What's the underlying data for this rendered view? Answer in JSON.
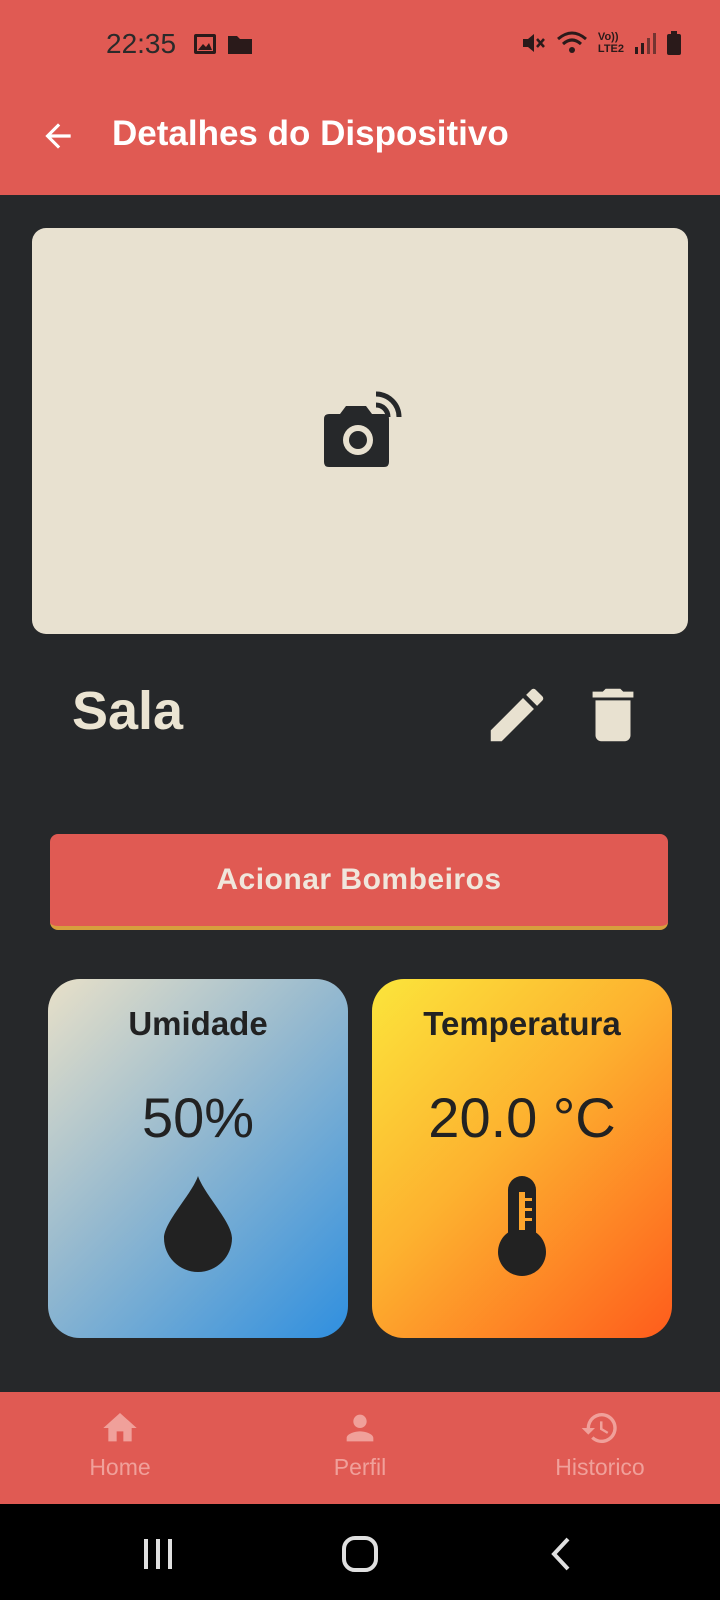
{
  "status_bar": {
    "time": "22:35",
    "icons_left": [
      "image-icon",
      "folder-icon"
    ],
    "icons_right": [
      "mute-icon",
      "wifi-icon",
      "volte-icon",
      "signal-icon",
      "battery-icon"
    ],
    "volte_text_1": "Vo))",
    "volte_text_2": "LTE2"
  },
  "app_bar": {
    "title": "Detalhes do Dispositivo",
    "back_icon": "arrow-back-icon",
    "color": "#e05a53"
  },
  "device": {
    "image_placeholder_icon": "camera-wireless-icon",
    "name": "Sala",
    "edit_icon": "pencil-icon",
    "delete_icon": "trash-icon"
  },
  "actions": {
    "alarm_label": "Acionar Bombeiros"
  },
  "sensors": {
    "humidity": {
      "title": "Umidade",
      "value": "50%",
      "icon": "water-drop-icon"
    },
    "temperature": {
      "title": "Temperatura",
      "value": "20.0 °C",
      "icon": "thermometer-icon"
    }
  },
  "bottom_nav": {
    "items": [
      {
        "label": "Home",
        "icon": "home-icon"
      },
      {
        "label": "Perfil",
        "icon": "person-icon"
      },
      {
        "label": "Historico",
        "icon": "history-icon"
      }
    ]
  },
  "system_nav": [
    "recents-icon",
    "home-circle-icon",
    "back-chevron-icon"
  ]
}
